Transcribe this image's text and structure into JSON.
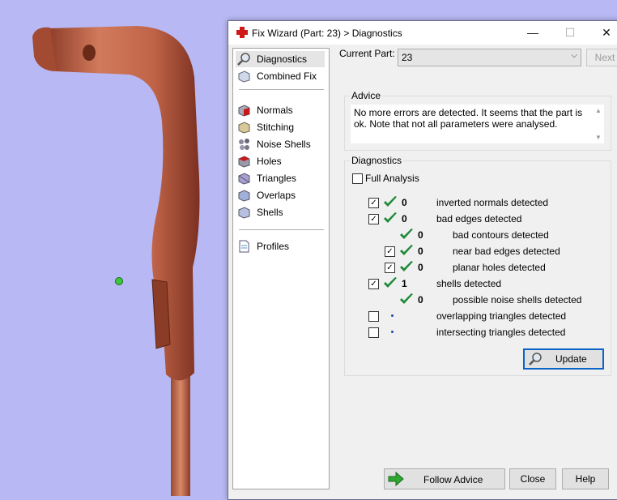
{
  "window": {
    "title": "Fix Wizard (Part: 23) > Diagnostics",
    "minimize_glyph": "—",
    "maximize_glyph": "☐",
    "close_glyph": "✕"
  },
  "nav": {
    "items": [
      {
        "label": "Diagnostics",
        "icon": "magnifier-icon",
        "selected": true
      },
      {
        "label": "Combined Fix",
        "icon": "cube-icon"
      },
      {
        "label": "Normals",
        "icon": "normals-icon"
      },
      {
        "label": "Stitching",
        "icon": "stitching-icon"
      },
      {
        "label": "Noise Shells",
        "icon": "noise-shells-icon"
      },
      {
        "label": "Holes",
        "icon": "holes-icon"
      },
      {
        "label": "Triangles",
        "icon": "triangles-icon"
      },
      {
        "label": "Overlaps",
        "icon": "overlaps-icon"
      },
      {
        "label": "Shells",
        "icon": "shells-icon"
      },
      {
        "label": "Profiles",
        "icon": "document-icon"
      }
    ]
  },
  "current_part": {
    "label": "Current Part:",
    "value": "23",
    "next_label": "Next"
  },
  "advice": {
    "title": "Advice",
    "text": "No more errors are detected. It seems that the part is ok. Note that not all parameters were analysed."
  },
  "diagnostics": {
    "title": "Diagnostics",
    "full_analysis_label": "Full Analysis",
    "full_analysis_checked": false,
    "rows": [
      {
        "checked": true,
        "status": "ok",
        "count": "0",
        "label": "inverted normals detected",
        "indent": 0
      },
      {
        "checked": true,
        "status": "ok",
        "count": "0",
        "label": "bad edges detected",
        "indent": 0
      },
      {
        "checked": null,
        "status": "ok",
        "count": "0",
        "label": "bad contours detected",
        "indent": 1
      },
      {
        "checked": true,
        "status": "ok",
        "count": "0",
        "label": "near bad edges detected",
        "indent": 1
      },
      {
        "checked": true,
        "status": "ok",
        "count": "0",
        "label": "planar holes detected",
        "indent": 1
      },
      {
        "checked": true,
        "status": "ok",
        "count": "1",
        "label": "shells detected",
        "indent": 0
      },
      {
        "checked": null,
        "status": "ok",
        "count": "0",
        "label": "possible noise shells detected",
        "indent": 1
      },
      {
        "checked": false,
        "status": "none",
        "count": "",
        "label": "overlapping triangles detected",
        "indent": 0
      },
      {
        "checked": false,
        "status": "none",
        "count": "",
        "label": "intersecting triangles detected",
        "indent": 0
      }
    ],
    "update_label": "Update"
  },
  "footer": {
    "follow_advice_label": "Follow Advice",
    "close_label": "Close",
    "help_label": "Help"
  },
  "colors": {
    "viewport_bg": "#b8b8f4",
    "part_color": "#c86a4e",
    "check_green": "#1f8a3a",
    "accent_blue": "#0a64c8"
  }
}
